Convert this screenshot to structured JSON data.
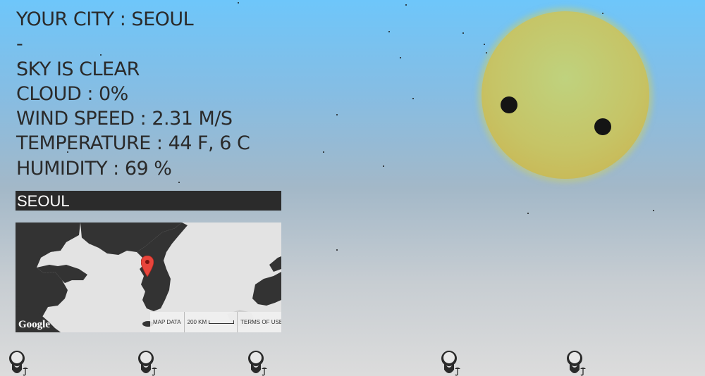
{
  "weather": {
    "city_line": "YOUR CITY : SEOUL",
    "separator": "-",
    "sky_line": "SKY IS CLEAR",
    "cloud_line": "CLOUD : 0%",
    "wind_line": "WIND SPEED : 2.31 M/S",
    "temperature_line": "TEMPERATURE : 44 F, 6 C",
    "humidity_line": "HUMIDITY : 69 %"
  },
  "map": {
    "title": "SEOUL",
    "google_logo": "Google",
    "map_data_label": "MAP DATA",
    "scale_label": "200 KM",
    "terms_label": "TERMS OF USE"
  },
  "colors": {
    "sky_top": "#6ec6fa",
    "sky_bottom": "#dcdcdc",
    "sun": "#c6c466",
    "title_bar": "#2b2b2b",
    "pin": "#e8453c"
  },
  "icons": {
    "sun": "smiling-sun-icon",
    "pin": "map-pin-icon",
    "character": "bearded-man-with-umbrella-icon"
  }
}
